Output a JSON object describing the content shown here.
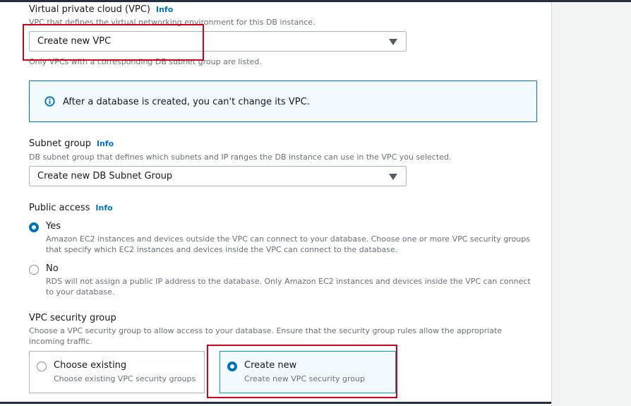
{
  "vpc": {
    "label": "Virtual private cloud (VPC)",
    "info": "Info",
    "description": "VPC that defines the virtual networking environment for this DB instance.",
    "selected": "Create new VPC",
    "hint": "Only VPCs with a corresponding DB subnet group are listed."
  },
  "alert": {
    "icon": "info-circle-icon",
    "text": "After a database is created, you can't change its VPC."
  },
  "subnet": {
    "label": "Subnet group",
    "info": "Info",
    "description": "DB subnet group that defines which subnets and IP ranges the DB instance can use in the VPC you selected.",
    "selected": "Create new DB Subnet Group"
  },
  "public_access": {
    "label": "Public access",
    "info": "Info",
    "options": [
      {
        "title": "Yes",
        "checked": true,
        "description": "Amazon EC2 instances and devices outside the VPC can connect to your database. Choose one or more VPC security groups that specify which EC2 instances and devices inside the VPC can connect to the database."
      },
      {
        "title": "No",
        "checked": false,
        "description": "RDS will not assign a public IP address to the database. Only Amazon EC2 instances and devices inside the VPC can connect to your database."
      }
    ]
  },
  "security_group": {
    "label": "VPC security group",
    "description": "Choose a VPC security group to allow access to your database. Ensure that the security group rules allow the appropriate incoming traffic.",
    "tiles": [
      {
        "title": "Choose existing",
        "description": "Choose existing VPC security groups",
        "selected": false
      },
      {
        "title": "Create new",
        "description": "Create new VPC security group",
        "selected": true
      }
    ]
  },
  "colors": {
    "accent": "#0073bb",
    "highlight": "#d0021b",
    "alert_bg": "#f1faff"
  }
}
